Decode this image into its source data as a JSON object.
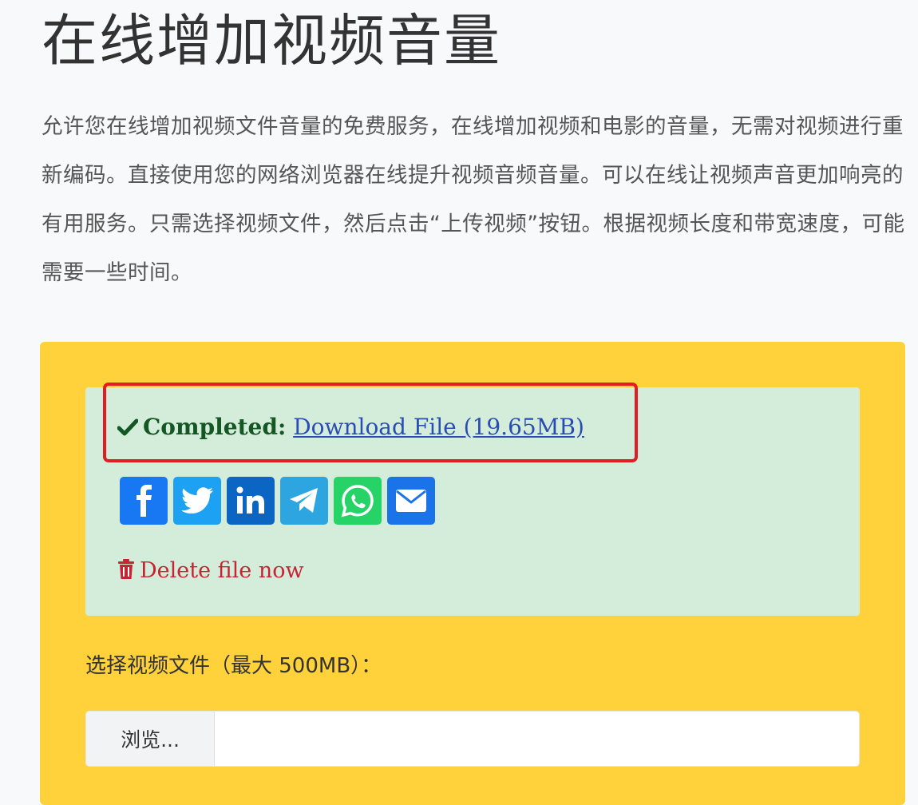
{
  "page": {
    "title": "在线增加视频音量",
    "intro": "允许您在线增加视频文件音量的免费服务，在线增加视频和电影的音量，无需对视频进行重新编码。直接使用您的网络浏览器在线提升视频音频音量。可以在线让视频声音更加响亮的有用服务。只需选择视频文件，然后点击“上传视频”按钮。根据视频长度和带宽速度，可能需要一些时间。"
  },
  "result": {
    "status_label": "Completed:",
    "download_label": "Download File (19.65MB)",
    "delete_label": "Delete file now",
    "share_buttons": [
      {
        "name": "facebook",
        "color": "#1877f2",
        "icon": "facebook-icon"
      },
      {
        "name": "twitter",
        "color": "#1da1f2",
        "icon": "twitter-icon"
      },
      {
        "name": "linkedin",
        "color": "#0a66c2",
        "icon": "linkedin-icon"
      },
      {
        "name": "telegram",
        "color": "#2ca5e0",
        "icon": "telegram-icon"
      },
      {
        "name": "whatsapp",
        "color": "#25d366",
        "icon": "whatsapp-icon"
      },
      {
        "name": "email",
        "color": "#1a73e8",
        "icon": "email-icon"
      }
    ]
  },
  "upload": {
    "file_label": "选择视频文件（最大 500MB）：",
    "browse_label": "浏览..."
  },
  "colors": {
    "panel": "#ffd13b",
    "success_bg": "#d4edda",
    "highlight_border": "#e31b23",
    "danger": "#c82333",
    "link": "#2a4db3"
  }
}
